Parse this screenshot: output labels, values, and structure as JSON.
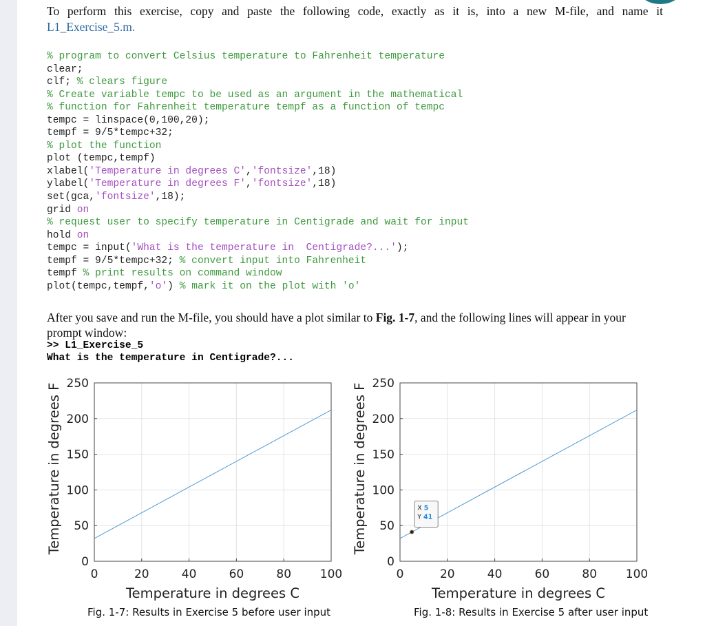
{
  "intro": {
    "text": "To perform this exercise, copy and paste the following code, exactly as it is, into a new M-file, and name it",
    "filename": "L1_Exercise_5.m."
  },
  "code": [
    [
      [
        "c",
        "% program to convert Celsius temperature to Fahrenheit temperature"
      ]
    ],
    [
      [
        "t",
        "clear;"
      ]
    ],
    [
      [
        "t",
        "clf; "
      ],
      [
        "c",
        "% clears figure"
      ]
    ],
    [
      [
        "c",
        "% Create variable tempc to be used as an argument in the mathematical"
      ]
    ],
    [
      [
        "c",
        "% function for Fahrenheit temperature tempf as a function of tempc"
      ]
    ],
    [
      [
        "t",
        "tempc = linspace(0,100,20);"
      ]
    ],
    [
      [
        "t",
        "tempf = 9/5*tempc+32;"
      ]
    ],
    [
      [
        "c",
        "% plot the function"
      ]
    ],
    [
      [
        "t",
        "plot (tempc,tempf)"
      ]
    ],
    [
      [
        "t",
        "xlabel("
      ],
      [
        "s",
        "'Temperature in degrees C'"
      ],
      [
        "t",
        ","
      ],
      [
        "s",
        "'fontsize'"
      ],
      [
        "t",
        ",18)"
      ]
    ],
    [
      [
        "t",
        "ylabel("
      ],
      [
        "s",
        "'Temperature in degrees F'"
      ],
      [
        "t",
        ","
      ],
      [
        "s",
        "'fontsize'"
      ],
      [
        "t",
        ",18)"
      ]
    ],
    [
      [
        "t",
        "set(gca,"
      ],
      [
        "s",
        "'fontsize'"
      ],
      [
        "t",
        ",18);"
      ]
    ],
    [
      [
        "t",
        "grid "
      ],
      [
        "s",
        "on"
      ]
    ],
    [
      [
        "c",
        "% request user to specify temperature in Centigrade and wait for input"
      ]
    ],
    [
      [
        "t",
        "hold "
      ],
      [
        "s",
        "on"
      ]
    ],
    [
      [
        "t",
        "tempc = input("
      ],
      [
        "s",
        "'What is the temperature in  Centigrade?...'"
      ],
      [
        "t",
        ");"
      ]
    ],
    [
      [
        "t",
        "tempf = 9/5*tempc+32; "
      ],
      [
        "c",
        "% convert input into Fahrenheit"
      ]
    ],
    [
      [
        "t",
        "tempf "
      ],
      [
        "c",
        "% print results on command window"
      ]
    ],
    [
      [
        "t",
        "plot(tempc,tempf,"
      ],
      [
        "s",
        "'o'"
      ],
      [
        "t",
        ") "
      ],
      [
        "c",
        "% mark it on the plot with 'o'"
      ]
    ]
  ],
  "after": {
    "pre": "After you save and run the M-file, you should have a plot similar to ",
    "fig": "Fig. 1-7",
    "post": ", and the following lines will appear in your prompt window:"
  },
  "prompt": [
    ">> L1_Exercise_5",
    "What is the temperature in Centigrade?..."
  ],
  "colors": {
    "line": "#3a8fd0",
    "grid": "#e4e4e4"
  },
  "chart_data": [
    {
      "type": "line",
      "xlabel": "Temperature in degrees C",
      "ylabel": "Temperature in degrees F",
      "xlim": [
        0,
        100
      ],
      "ylim": [
        0,
        250
      ],
      "xticks": [
        "0",
        "20",
        "40",
        "60",
        "80",
        "100"
      ],
      "yticks": [
        "0",
        "50",
        "100",
        "150",
        "200",
        "250"
      ],
      "grid": true,
      "x": [
        0,
        100
      ],
      "y": [
        32,
        212
      ],
      "caption": "Fig. 1-7: Results in Exercise 5 before user input"
    },
    {
      "type": "line",
      "xlabel": "Temperature in degrees C",
      "ylabel": "Temperature in degrees F",
      "xlim": [
        0,
        100
      ],
      "ylim": [
        0,
        250
      ],
      "xticks": [
        "0",
        "20",
        "40",
        "60",
        "80",
        "100"
      ],
      "yticks": [
        "0",
        "50",
        "100",
        "150",
        "200",
        "250"
      ],
      "grid": true,
      "x": [
        0,
        100
      ],
      "y": [
        32,
        212
      ],
      "marker": {
        "x": 5,
        "y": 41
      },
      "datatip": {
        "xlabel": "X",
        "xval": "5",
        "ylabel": "Y",
        "yval": "41"
      },
      "caption": "Fig. 1-8: Results in Exercise 5 after user input"
    }
  ]
}
